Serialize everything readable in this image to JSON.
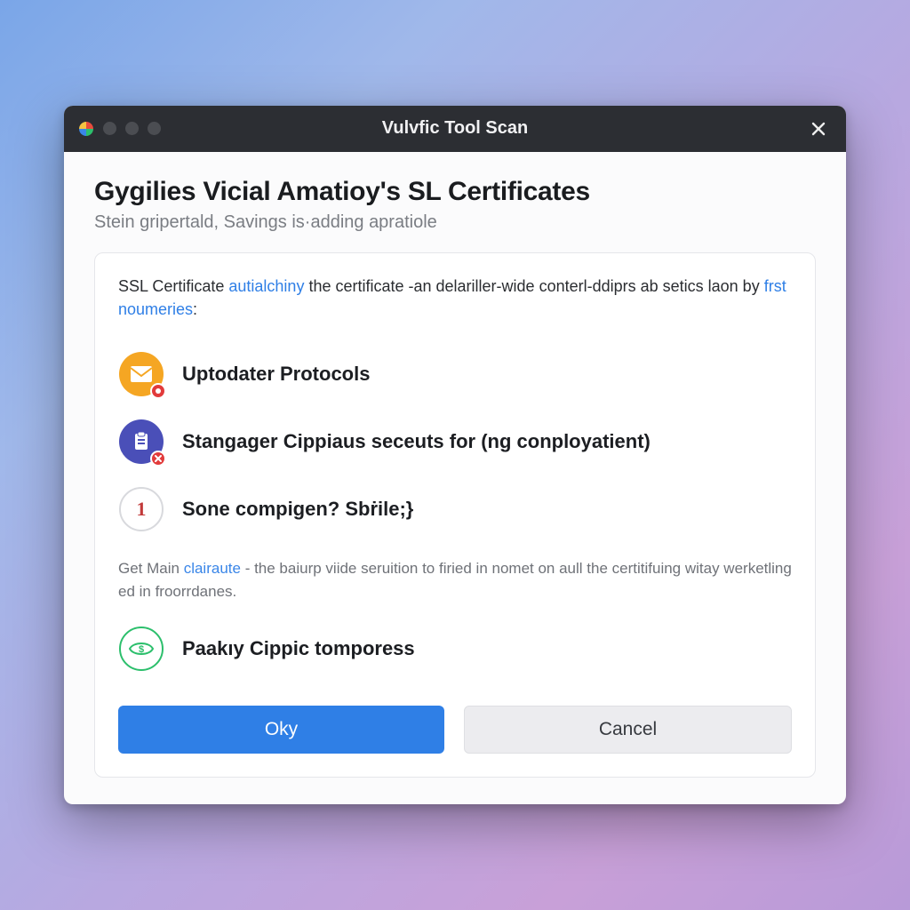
{
  "window": {
    "title": "Vulvfic Tool Scan"
  },
  "header": {
    "heading": "Gygilies Vicial Amatioy's SL Certificates",
    "subtitle": "Stein gripertald, Savings is·adding apratiole"
  },
  "panel": {
    "intro_prefix": "SSL Certificate ",
    "intro_link1": "autialchiny",
    "intro_mid": " the certificate -an delariller-wide conterl-ddiprs ab setics laon by ",
    "intro_link2": "frst noumeries",
    "intro_suffix": ":",
    "items": [
      {
        "label": "Uptodater Protocols",
        "icon": "mail-icon",
        "badge": "alert"
      },
      {
        "label": "Stangager Cippiaus seceuts for (ng conployatient)",
        "icon": "clipboard-icon",
        "badge": "x"
      },
      {
        "label": "Sone compigen? Sbṙile;}",
        "icon": "alert-number-icon",
        "badge": null
      }
    ],
    "note_prefix": "Get Main ",
    "note_link": "clairaute",
    "note_suffix": " - the baiurp viide seruition to firied in nomet on aull the certitifuing witay werketling ed in froorrdanes.",
    "final_item": {
      "label": "Paakıy Cippic tomporess",
      "icon": "eye-money-icon"
    }
  },
  "buttons": {
    "ok": "Oky",
    "cancel": "Cancel"
  },
  "colors": {
    "primary": "#2f7fe6",
    "titlebar": "#2c2e33",
    "mail_bg": "#f5a623",
    "clipboard_bg": "#4a4fb8",
    "alert_ring": "#d8d9dd",
    "alert_text": "#c23a3a",
    "eye_ring": "#2cbf6c"
  }
}
